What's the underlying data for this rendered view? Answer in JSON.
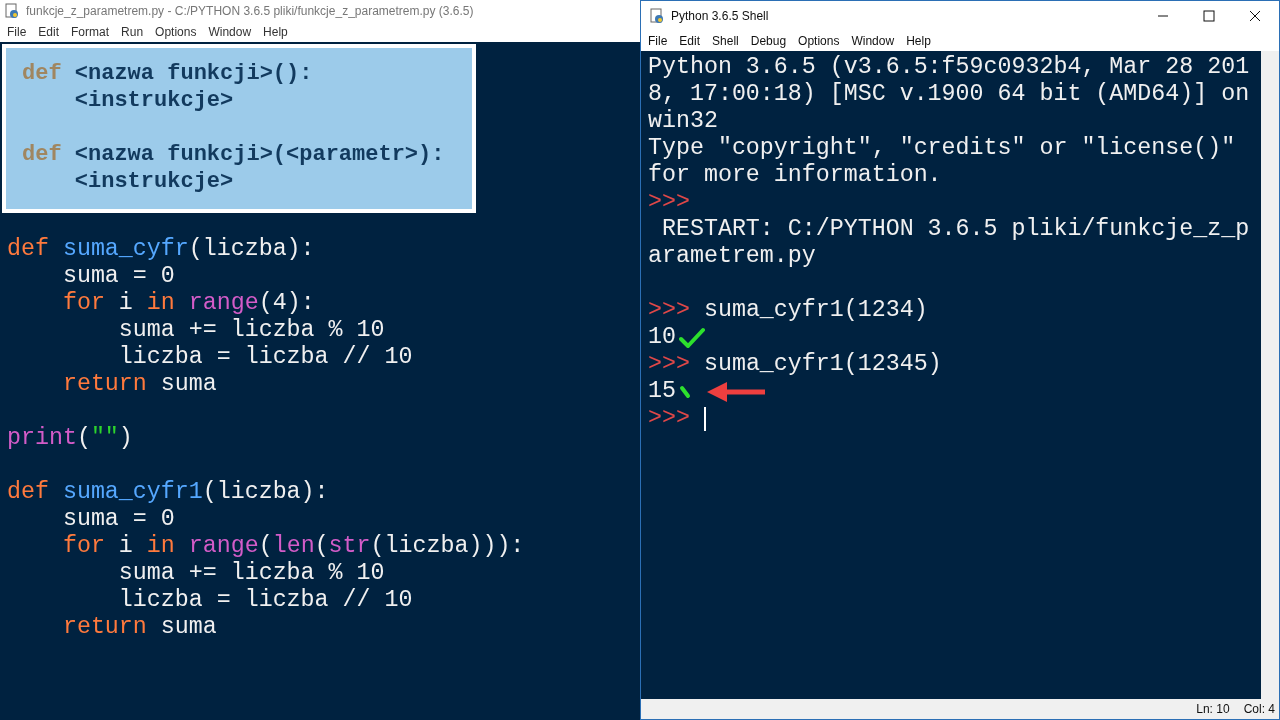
{
  "editor": {
    "title": "funkcje_z_parametrem.py - C:/PYTHON 3.6.5 pliki/funkcje_z_parametrem.py (3.6.5)",
    "menu": [
      "File",
      "Edit",
      "Format",
      "Run",
      "Options",
      "Window",
      "Help"
    ],
    "overlay": {
      "blocks": [
        [
          [
            {
              "t": "def",
              "kind": "keyword"
            },
            {
              "t": " <nazwa funkcji>():",
              "kind": "text"
            }
          ],
          [
            {
              "t": "    <instrukcje>",
              "kind": "text"
            }
          ]
        ],
        [
          [
            {
              "t": "def",
              "kind": "keyword"
            },
            {
              "t": " <nazwa funkcji>(<parametr>):",
              "kind": "text"
            }
          ],
          [
            {
              "t": "    <instrukcje>",
              "kind": "text"
            }
          ]
        ]
      ]
    },
    "code_blocks": [
      [
        [
          {
            "t": "def ",
            "kind": "keyword"
          },
          {
            "t": "suma_cyfr",
            "kind": "definition"
          },
          {
            "t": "(liczba):",
            "kind": "text"
          }
        ],
        [
          {
            "t": "    suma = 0",
            "kind": "text"
          }
        ],
        [
          {
            "t": "    for",
            "kind": "keyword"
          },
          {
            "t": " i ",
            "kind": "text"
          },
          {
            "t": "in",
            "kind": "keyword"
          },
          {
            "t": " range",
            "kind": "builtin"
          },
          {
            "t": "(4):",
            "kind": "text"
          }
        ],
        [
          {
            "t": "        suma += liczba % 10",
            "kind": "text"
          }
        ],
        [
          {
            "t": "        liczba = liczba // 10",
            "kind": "text"
          }
        ],
        [
          {
            "t": "    return",
            "kind": "keyword"
          },
          {
            "t": " suma",
            "kind": "text"
          }
        ]
      ],
      [
        [
          {
            "t": "print",
            "kind": "builtin"
          },
          {
            "t": "(",
            "kind": "text"
          },
          {
            "t": "\"\"",
            "kind": "string"
          },
          {
            "t": ")",
            "kind": "text"
          }
        ]
      ],
      [
        [
          {
            "t": "def ",
            "kind": "keyword"
          },
          {
            "t": "suma_cyfr1",
            "kind": "definition"
          },
          {
            "t": "(liczba):",
            "kind": "text"
          }
        ],
        [
          {
            "t": "    suma = 0",
            "kind": "text"
          }
        ],
        [
          {
            "t": "    for",
            "kind": "keyword"
          },
          {
            "t": " i ",
            "kind": "text"
          },
          {
            "t": "in",
            "kind": "keyword"
          },
          {
            "t": " range",
            "kind": "builtin"
          },
          {
            "t": "(",
            "kind": "text"
          },
          {
            "t": "len",
            "kind": "builtin"
          },
          {
            "t": "(",
            "kind": "text"
          },
          {
            "t": "str",
            "kind": "builtin"
          },
          {
            "t": "(liczba))):",
            "kind": "text"
          }
        ],
        [
          {
            "t": "        suma += liczba % 10",
            "kind": "text"
          }
        ],
        [
          {
            "t": "        liczba = liczba // 10",
            "kind": "text"
          }
        ],
        [
          {
            "t": "    return",
            "kind": "keyword"
          },
          {
            "t": " suma",
            "kind": "text"
          }
        ]
      ]
    ]
  },
  "shell": {
    "title": "Python 3.6.5 Shell",
    "menu": [
      "File",
      "Edit",
      "Shell",
      "Debug",
      "Options",
      "Window",
      "Help"
    ],
    "blocks": [
      [
        {
          "kind": "output",
          "text": "Python 3.6.5 (v3.6.5:f59c0932b4, Mar 28 201"
        },
        {
          "kind": "output",
          "text": "8, 17:00:18) [MSC v.1900 64 bit (AMD64)] on"
        },
        {
          "kind": "output",
          "text": "win32"
        },
        {
          "kind": "output",
          "text": "Type \"copyright\", \"credits\" or \"license()\""
        },
        {
          "kind": "output",
          "text": "for more information."
        },
        {
          "kind": "prompt",
          "prompt": ">>>"
        },
        {
          "kind": "output",
          "text": " RESTART: C:/PYTHON 3.6.5 pliki/funkcje_z_p"
        },
        {
          "kind": "output",
          "text": "arametrem.py"
        }
      ],
      [
        {
          "kind": "prompt",
          "prompt": ">>>",
          "text": "suma_cyfr1(1234)"
        },
        {
          "kind": "result",
          "text": "10",
          "annotation": {
            "kind": "check"
          }
        },
        {
          "kind": "prompt",
          "prompt": ">>>",
          "text": "suma_cyfr1(12345)"
        },
        {
          "kind": "result",
          "text": "15",
          "annotation": {
            "kind": "partial"
          }
        },
        {
          "kind": "prompt",
          "prompt": ">>>",
          "cursor": true
        }
      ]
    ],
    "status": {
      "line": "Ln: 10",
      "col": "Col: 4"
    }
  }
}
